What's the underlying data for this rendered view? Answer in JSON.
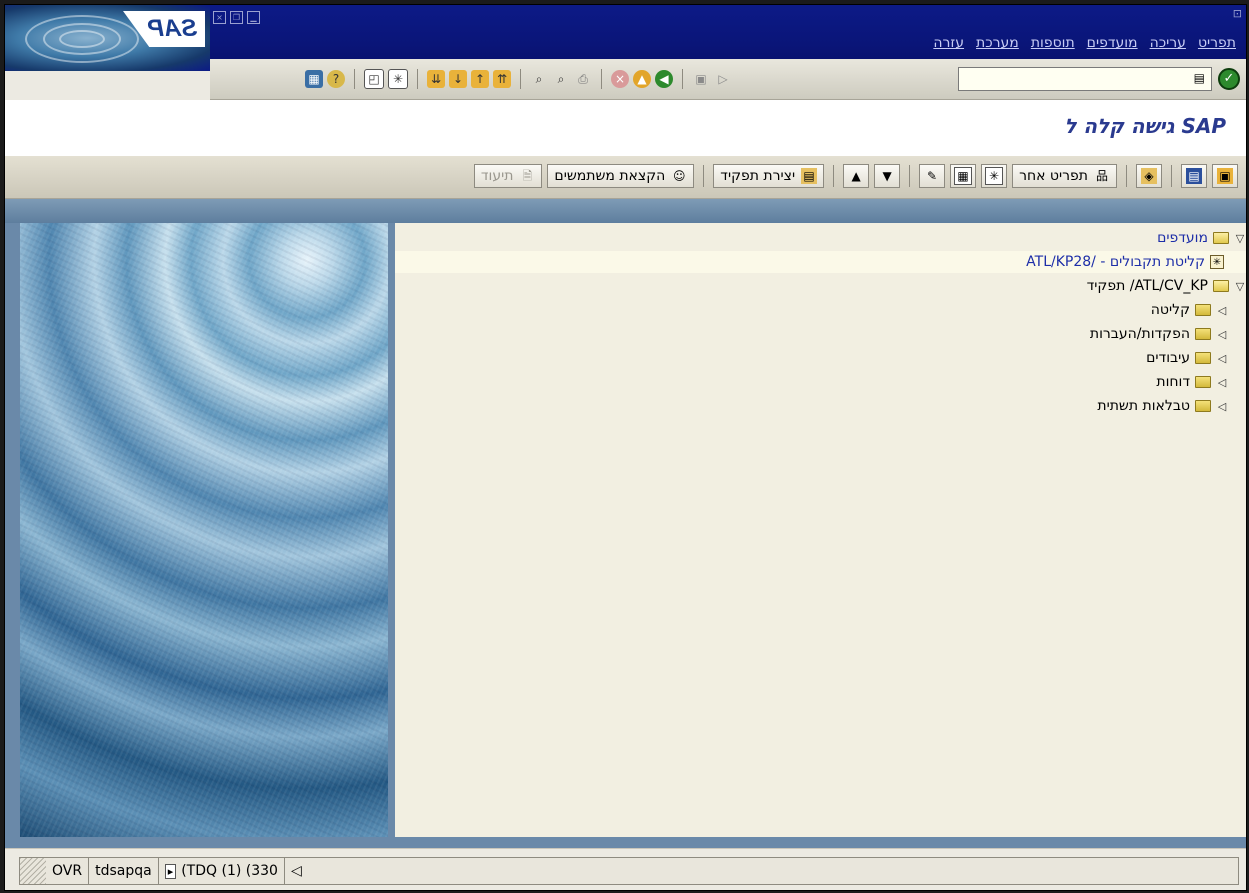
{
  "window": {
    "logo_text": "SAP",
    "menu": [
      "תפריט",
      "עריכה",
      "מועדפים",
      "תוספות",
      "מערכת",
      "עזרה"
    ]
  },
  "standard_toolbar": {
    "command_field_value": "",
    "icons": [
      "ok-icon",
      "history-icon",
      "back-icon",
      "exit-icon",
      "cancel-icon",
      "save-icon",
      "print-icon",
      "find-icon",
      "find-next-icon",
      "first-page-icon",
      "previous-page-icon",
      "next-page-icon",
      "last-page-icon",
      "create-session-icon",
      "shortcut-icon",
      "help-icon",
      "layout-icon"
    ]
  },
  "header": {
    "title": "גישה קלה ל SAP"
  },
  "app_toolbar": {
    "buttons": [
      {
        "label": "",
        "icon": "menu-icon"
      },
      {
        "label": "",
        "icon": "sap-menu-icon"
      },
      {
        "label": "",
        "icon": "other-icon"
      },
      {
        "label": "תפריט אחר",
        "icon": "hierarchy-icon"
      },
      {
        "label": "",
        "icon": "add-favorite-icon"
      },
      {
        "label": "",
        "icon": "delete-favorite-icon"
      },
      {
        "label": "",
        "icon": "change-favorite-icon"
      },
      {
        "label": "",
        "icon": "move-down-icon"
      },
      {
        "label": "",
        "icon": "move-up-icon"
      },
      {
        "label": "יצירת תפקיד",
        "icon": "create-role-icon"
      },
      {
        "label": "הקצאת משתמשים",
        "icon": "assign-users-icon"
      },
      {
        "label": "תיעוד",
        "icon": "documentation-icon"
      }
    ]
  },
  "tree": {
    "favorites_label": "מועדפים",
    "favorite_item": "ATL/KP28/ - קליטת תקבולים",
    "role_label": "תפקיד /ATL/CV_KP",
    "role_items": [
      "קליטה",
      "הפקדות/העברות",
      "עיבודים",
      "דוחות",
      "טבלאות תשתית"
    ]
  },
  "status_bar": {
    "system": "(TDQ (1) (330",
    "server": "tdsapqa",
    "mode": "OVR"
  }
}
